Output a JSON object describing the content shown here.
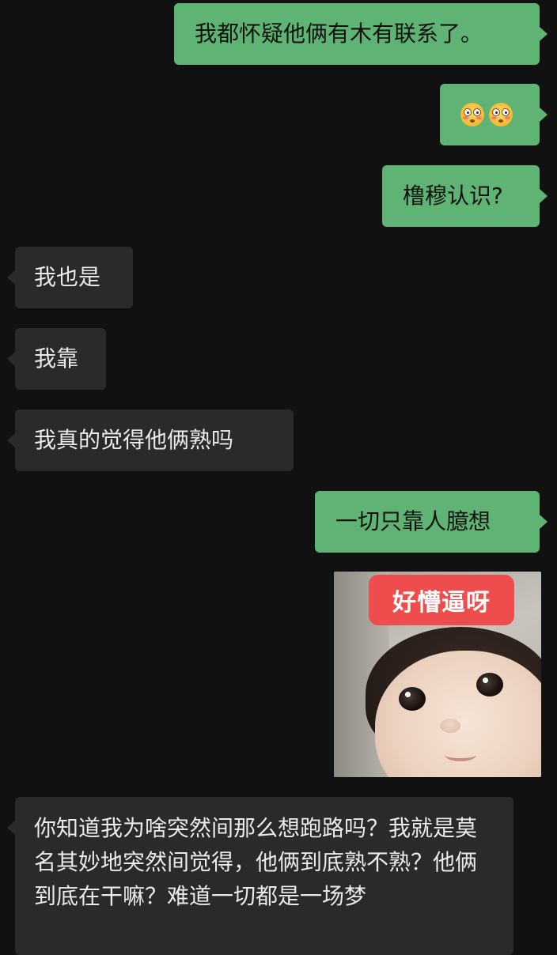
{
  "messages": [
    {
      "from": "me",
      "text": "我都怀疑他俩有木有联系了。"
    },
    {
      "from": "me",
      "type": "emoji",
      "emoji": [
        "flushed-face-emoji",
        "flushed-face-emoji"
      ]
    },
    {
      "from": "me",
      "text": "橹穆认识?"
    },
    {
      "from": "them",
      "text": "我也是"
    },
    {
      "from": "them",
      "text": "我靠"
    },
    {
      "from": "them",
      "text": "我真的觉得他俩熟吗"
    },
    {
      "from": "me",
      "text": "一切只靠人臆想"
    },
    {
      "from": "me",
      "type": "sticker",
      "caption": "好懵逼呀",
      "description": "baby-face-sticker"
    },
    {
      "from": "them",
      "text": "你知道我为啥突然间那么想跑路吗？我就是莫名其妙地突然间觉得，他俩到底熟不熟？他俩到底在干嘛？难道一切都是一场梦"
    }
  ],
  "colors": {
    "background": "#111111",
    "outgoing_bubble": "#5fb374",
    "incoming_bubble": "#2a2a2a",
    "sticker_caption": "#ee4d4d"
  }
}
